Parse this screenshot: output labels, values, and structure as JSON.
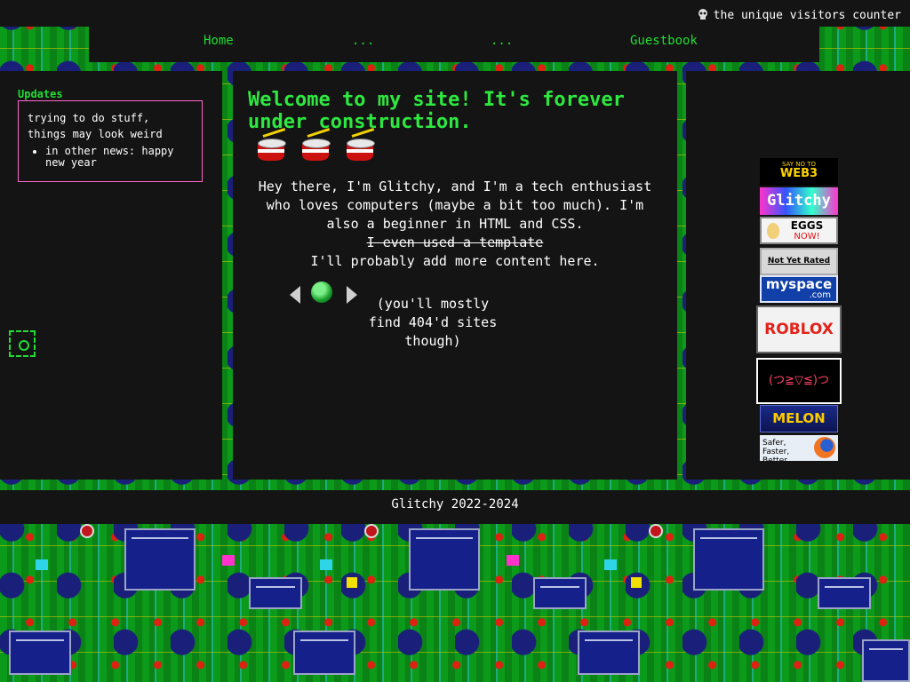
{
  "header": {
    "counter_label": "the unique visitors counter",
    "counter_icon": "skull-icon"
  },
  "nav": {
    "home": "Home",
    "link2": "...",
    "link3": "...",
    "guestbook": "Guestbook"
  },
  "updates": {
    "title": "Updates",
    "text": "trying to do stuff, things may look weird",
    "items": [
      "in other news: happy new year"
    ]
  },
  "main": {
    "welcome": "Welcome to my site! It's forever under construction.",
    "intro": "Hey there, I'm Glitchy, and I'm a tech enthusiast who loves computers (maybe a bit too much). I'm also a beginner in HTML and CSS.",
    "strike": "I even used a template",
    "more": "I'll probably add more content here.",
    "webring_note": "(you'll mostly find 404'd sites though)"
  },
  "buttons": {
    "web3_top": "SAY NO TO",
    "web3_bottom": "WEB3",
    "glitchy": "Glitchy",
    "eggs": "EGGS",
    "eggs_now": "NOW!",
    "not_yet_rated": "Not Yet Rated",
    "myspace": "myspace",
    "myspace_com": ".com",
    "roblox": "ROBLOX",
    "kaomoji": "(つ≧▽≦)つ",
    "melon": "MELON",
    "firefox": "Safer, Faster, Better"
  },
  "footer": {
    "text": "Glitchy 2022-2024"
  },
  "colors": {
    "accent_green": "#22dd33",
    "panel_bg": "#141414",
    "updates_border": "#ff66cc",
    "pcb_green": "#0a8f18"
  }
}
